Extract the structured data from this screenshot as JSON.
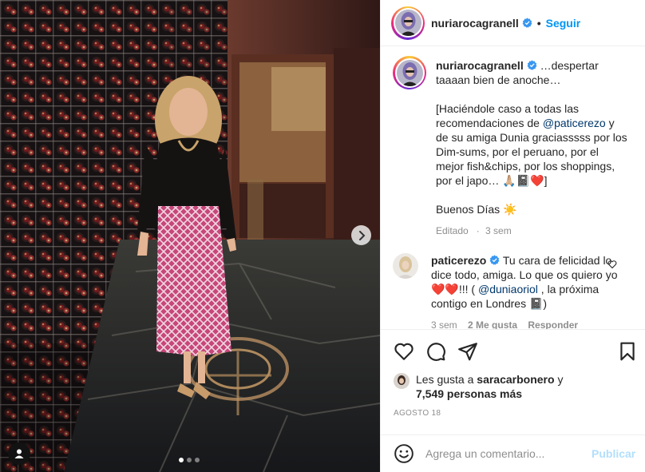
{
  "post": {
    "author": "nuriarocagranell",
    "follow_label": "Seguir",
    "bullet": "•",
    "caption": {
      "line1": "…despertar taaaan bien de anoche…",
      "p2_before": "[Haciéndole caso a todas las recomendaciones de ",
      "p2_mention": "@paticerezo",
      "p2_after": " y de su amiga Dunia graciasssss por los Dim-sums, por el peruano, por el mejor fish&chips, por los shoppings, por el japo… 🙏🏼📓❤️]",
      "p3": "Buenos Días ☀️",
      "edited": "Editado",
      "time": "3 sem"
    },
    "comment": {
      "user": "paticerezo",
      "text_before": "Tu cara de felicidad lo dice todo, amiga. Lo que os quiero yo ❤️❤️!!! ( ",
      "mention": "@duniaoriol",
      "text_after": " , la próxima contigo en Londres 📓)",
      "time": "3 sem",
      "likes": "2 Me gusta",
      "reply": "Responder"
    },
    "likes": {
      "prefix": "Les gusta a ",
      "user": "saracarbonero",
      "conj": " y",
      "count": "7,549 personas más"
    },
    "date": "AGOSTO 18",
    "add_comment": {
      "placeholder": "Agrega un comentario...",
      "publish": "Publicar"
    },
    "carousel": {
      "count": 3,
      "active": 0
    }
  },
  "icons": {
    "verified": "verified-badge-icon",
    "like": "heart-icon",
    "comment": "comment-bubble-icon",
    "share": "paper-plane-icon",
    "save": "bookmark-icon",
    "emoji": "smiley-icon",
    "next": "chevron-right-icon",
    "tag": "user-tag-icon"
  },
  "colors": {
    "link_blue": "#0095f6",
    "mention_blue": "#00376b",
    "verified_blue": "#3897f0",
    "muted": "#8e8e8e",
    "publish_disabled": "#b2dffc"
  }
}
